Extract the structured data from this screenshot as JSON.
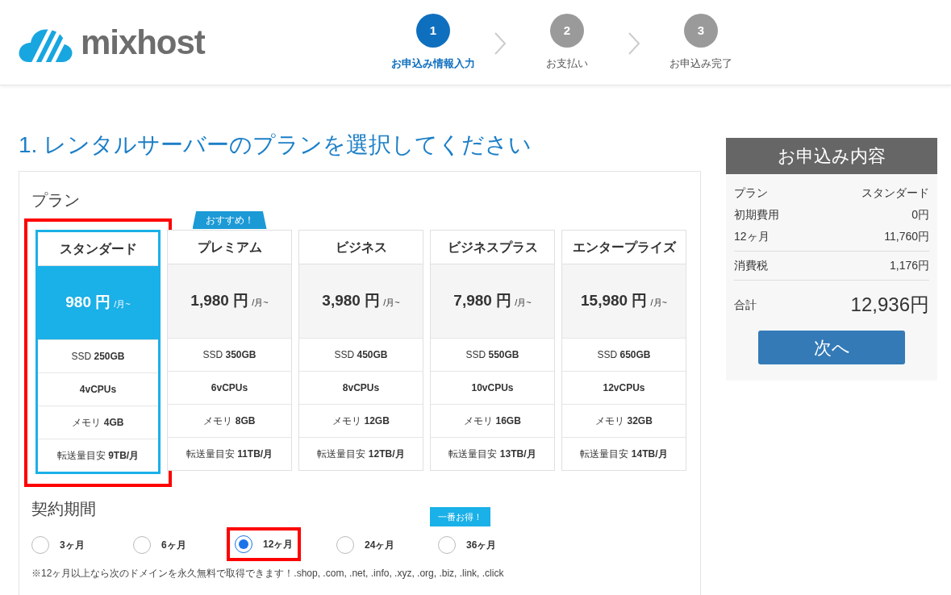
{
  "header": {
    "logo_text": "mixhost",
    "steps": [
      {
        "number": "1",
        "label": "お申込み情報入力",
        "selected": true
      },
      {
        "number": "2",
        "label": "お支払い",
        "selected": false
      },
      {
        "number": "3",
        "label": "お申込み完了",
        "selected": false
      }
    ]
  },
  "title": "1. レンタルサーバーのプランを選択してください",
  "plan_section": {
    "heading": "プラン",
    "plans": [
      {
        "name": "スタンダード",
        "price": "980 円",
        "unit": "/月~",
        "specs": [
          "SSD **250GB**",
          "**4vCPUs**",
          "メモリ **4GB**",
          "転送量目安 **9TB/月**"
        ],
        "selected": true,
        "highlighted": true
      },
      {
        "name": "プレミアム",
        "badge": "おすすめ！",
        "price": "1,980 円",
        "unit": "/月~",
        "specs": [
          "SSD **350GB**",
          "**6vCPUs**",
          "メモリ **8GB**",
          "転送量目安 **11TB/月**"
        ],
        "selected": false,
        "highlighted": false
      },
      {
        "name": "ビジネス",
        "price": "3,980 円",
        "unit": "/月~",
        "specs": [
          "SSD **450GB**",
          "**8vCPUs**",
          "メモリ **12GB**",
          "転送量目安 **12TB/月**"
        ],
        "selected": false,
        "highlighted": false
      },
      {
        "name": "ビジネスプラス",
        "price": "7,980 円",
        "unit": "/月~",
        "specs": [
          "SSD **550GB**",
          "**10vCPUs**",
          "メモリ **16GB**",
          "転送量目安 **13TB/月**"
        ],
        "selected": false,
        "highlighted": false
      },
      {
        "name": "エンタープライズ",
        "price": "15,980 円",
        "unit": "/月~",
        "specs": [
          "SSD **650GB**",
          "**12vCPUs**",
          "メモリ **32GB**",
          "転送量目安 **14TB/月**"
        ],
        "selected": false,
        "highlighted": false
      }
    ]
  },
  "period_section": {
    "heading": "契約期間",
    "options": [
      {
        "label": "3ヶ月",
        "selected": false,
        "highlighted": false
      },
      {
        "label": "6ヶ月",
        "selected": false,
        "highlighted": false
      },
      {
        "label": "12ヶ月",
        "selected": true,
        "highlighted": true
      },
      {
        "label": "24ヶ月",
        "selected": false,
        "highlighted": false
      },
      {
        "label": "36ヶ月",
        "badge": "一番お得！",
        "selected": false,
        "highlighted": false
      }
    ],
    "note": "※12ヶ月以上なら次のドメインを永久無料で取得できます！.shop, .com, .net, .info, .xyz, .org, .biz, .link, .click"
  },
  "summary": {
    "title": "お申込み内容",
    "groups": [
      [
        {
          "label": "プラン",
          "value": "スタンダード",
          "kind": "line"
        },
        {
          "label": "初期費用",
          "value": "0円",
          "kind": "line"
        },
        {
          "label": "12ヶ月",
          "value": "11,760円",
          "kind": "line"
        }
      ],
      [
        {
          "label": "消費税",
          "value": "1,176円",
          "kind": "line"
        }
      ],
      [
        {
          "label": "合計",
          "value": "12,936円",
          "kind": "total"
        }
      ]
    ],
    "button": "次へ"
  }
}
